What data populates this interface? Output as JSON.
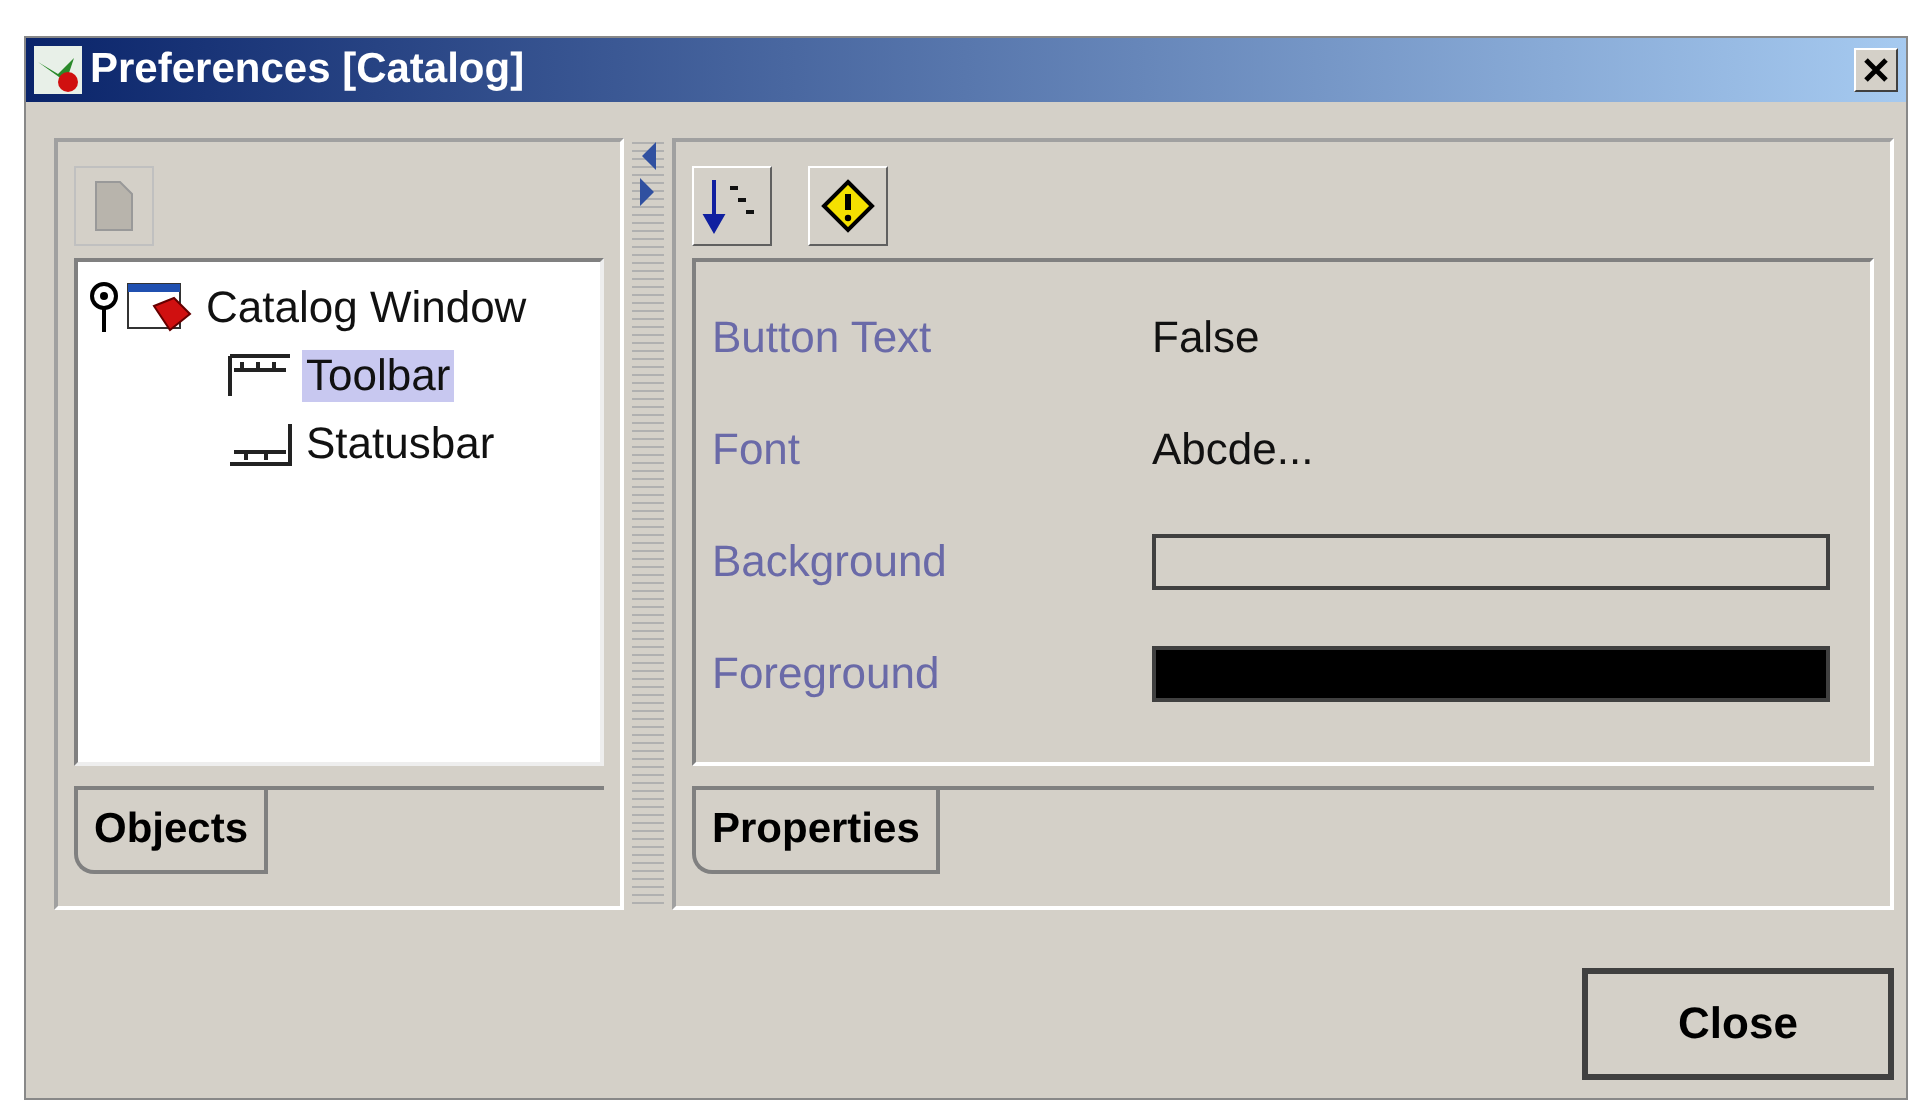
{
  "window": {
    "title": "Preferences [Catalog]"
  },
  "objects_tree": [
    {
      "label": "Catalog Window",
      "kind": "window",
      "selected": false,
      "children": [
        {
          "label": "Toolbar",
          "kind": "toolbar",
          "selected": true
        },
        {
          "label": "Statusbar",
          "kind": "statusbar",
          "selected": false
        }
      ]
    }
  ],
  "left_tabs": [
    {
      "label": "Objects",
      "selected": true
    }
  ],
  "properties": [
    {
      "name": "Button Text",
      "kind": "text",
      "value": "False"
    },
    {
      "name": "Font",
      "kind": "text",
      "value": "Abcde..."
    },
    {
      "name": "Background",
      "kind": "swatch",
      "color": "#d4d0c8"
    },
    {
      "name": "Foreground",
      "kind": "swatch",
      "color": "#000000"
    }
  ],
  "right_tabs": [
    {
      "label": "Properties",
      "selected": true
    }
  ],
  "buttons": [
    {
      "label": "Close"
    }
  ]
}
